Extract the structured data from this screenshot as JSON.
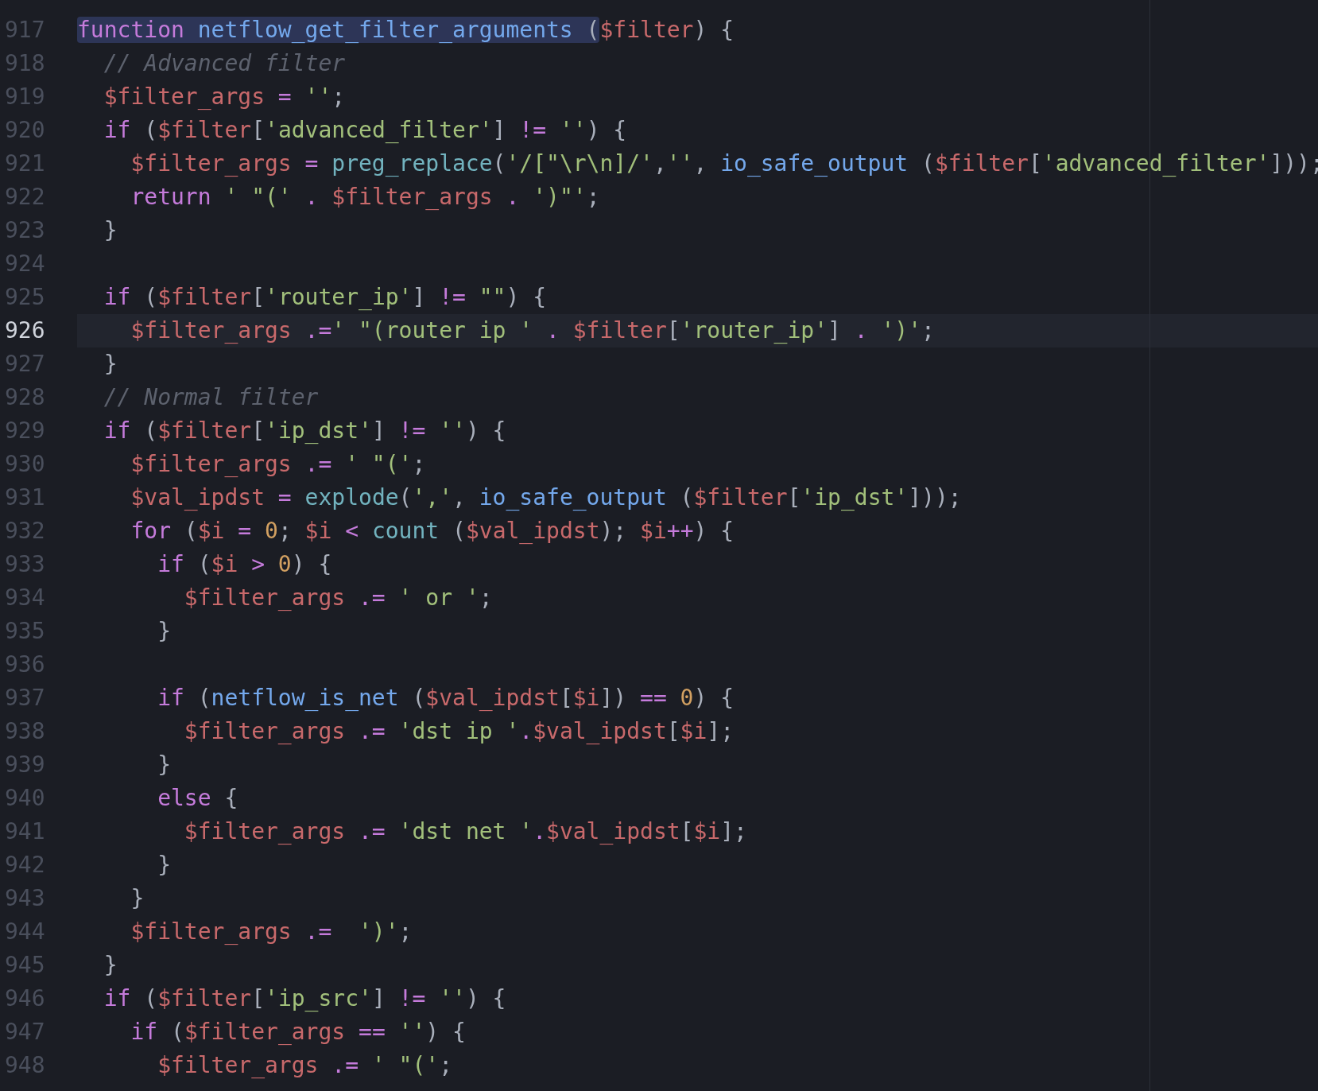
{
  "editor": {
    "lines": [
      {
        "number": "917",
        "current": false,
        "selection": [
          {
            "kind": "kw",
            "text": "function"
          },
          {
            "kind": "fn",
            "text": " netflow_get_filter_arguments"
          },
          {
            "kind": "p",
            "text": " ("
          }
        ],
        "tokens": [
          {
            "kind": "var",
            "text": "$filter"
          },
          {
            "kind": "p",
            "text": ") {"
          }
        ]
      },
      {
        "number": "918",
        "current": false,
        "tokens": [
          {
            "kind": "cm",
            "text": "  // Advanced filter"
          }
        ]
      },
      {
        "number": "919",
        "current": false,
        "tokens": [
          {
            "kind": "var",
            "text": "  $filter_args"
          },
          {
            "kind": "op",
            "text": " ="
          },
          {
            "kind": "str",
            "text": " ''"
          },
          {
            "kind": "p",
            "text": ";"
          }
        ]
      },
      {
        "number": "920",
        "current": false,
        "tokens": [
          {
            "kind": "kw",
            "text": "  if"
          },
          {
            "kind": "p",
            "text": " ("
          },
          {
            "kind": "var",
            "text": "$filter"
          },
          {
            "kind": "p",
            "text": "["
          },
          {
            "kind": "str",
            "text": "'advanced_filter'"
          },
          {
            "kind": "p",
            "text": "] "
          },
          {
            "kind": "op",
            "text": "!="
          },
          {
            "kind": "str",
            "text": " ''"
          },
          {
            "kind": "p",
            "text": ") {"
          }
        ]
      },
      {
        "number": "921",
        "current": false,
        "tokens": [
          {
            "kind": "var",
            "text": "    $filter_args"
          },
          {
            "kind": "op",
            "text": " ="
          },
          {
            "kind": "bi",
            "text": " preg_replace"
          },
          {
            "kind": "p",
            "text": "("
          },
          {
            "kind": "str",
            "text": "'/[\"\\r\\n]/'"
          },
          {
            "kind": "p",
            "text": ","
          },
          {
            "kind": "str",
            "text": "''"
          },
          {
            "kind": "p",
            "text": ", "
          },
          {
            "kind": "fn",
            "text": "io_safe_output"
          },
          {
            "kind": "p",
            "text": " ("
          },
          {
            "kind": "var",
            "text": "$filter"
          },
          {
            "kind": "p",
            "text": "["
          },
          {
            "kind": "str",
            "text": "'advanced_filter'"
          },
          {
            "kind": "p",
            "text": "]));"
          }
        ]
      },
      {
        "number": "922",
        "current": false,
        "tokens": [
          {
            "kind": "kw",
            "text": "    return"
          },
          {
            "kind": "str",
            "text": " ' \"('"
          },
          {
            "kind": "op",
            "text": " ."
          },
          {
            "kind": "var",
            "text": " $filter_args"
          },
          {
            "kind": "op",
            "text": " ."
          },
          {
            "kind": "str",
            "text": " ')\"'"
          },
          {
            "kind": "p",
            "text": ";"
          }
        ]
      },
      {
        "number": "923",
        "current": false,
        "tokens": [
          {
            "kind": "p",
            "text": "  }"
          }
        ]
      },
      {
        "number": "924",
        "current": false
      },
      {
        "number": "925",
        "current": false,
        "tokens": [
          {
            "kind": "kw",
            "text": "  if"
          },
          {
            "kind": "p",
            "text": " ("
          },
          {
            "kind": "var",
            "text": "$filter"
          },
          {
            "kind": "p",
            "text": "["
          },
          {
            "kind": "str",
            "text": "'router_ip'"
          },
          {
            "kind": "p",
            "text": "] "
          },
          {
            "kind": "op",
            "text": "!="
          },
          {
            "kind": "str",
            "text": " \"\""
          },
          {
            "kind": "p",
            "text": ") {"
          }
        ]
      },
      {
        "number": "926",
        "current": true,
        "tokens": [
          {
            "kind": "var",
            "text": "    $filter_args"
          },
          {
            "kind": "op",
            "text": " .="
          },
          {
            "kind": "str",
            "text": "' \"(router ip '"
          },
          {
            "kind": "op",
            "text": " ."
          },
          {
            "kind": "var",
            "text": " $filter"
          },
          {
            "kind": "p",
            "text": "["
          },
          {
            "kind": "str",
            "text": "'router_ip'"
          },
          {
            "kind": "p",
            "text": "] "
          },
          {
            "kind": "op",
            "text": "."
          },
          {
            "kind": "str",
            "text": " ')'"
          },
          {
            "kind": "p",
            "text": ";"
          }
        ]
      },
      {
        "number": "927",
        "current": false,
        "tokens": [
          {
            "kind": "p",
            "text": "  }"
          }
        ]
      },
      {
        "number": "928",
        "current": false,
        "tokens": [
          {
            "kind": "cm",
            "text": "  // Normal filter"
          }
        ]
      },
      {
        "number": "929",
        "current": false,
        "tokens": [
          {
            "kind": "kw",
            "text": "  if"
          },
          {
            "kind": "p",
            "text": " ("
          },
          {
            "kind": "var",
            "text": "$filter"
          },
          {
            "kind": "p",
            "text": "["
          },
          {
            "kind": "str",
            "text": "'ip_dst'"
          },
          {
            "kind": "p",
            "text": "] "
          },
          {
            "kind": "op",
            "text": "!="
          },
          {
            "kind": "str",
            "text": " ''"
          },
          {
            "kind": "p",
            "text": ") {"
          }
        ]
      },
      {
        "number": "930",
        "current": false,
        "tokens": [
          {
            "kind": "var",
            "text": "    $filter_args"
          },
          {
            "kind": "op",
            "text": " .="
          },
          {
            "kind": "str",
            "text": " ' \"('"
          },
          {
            "kind": "p",
            "text": ";"
          }
        ]
      },
      {
        "number": "931",
        "current": false,
        "tokens": [
          {
            "kind": "var",
            "text": "    $val_ipdst"
          },
          {
            "kind": "op",
            "text": " ="
          },
          {
            "kind": "bi",
            "text": " explode"
          },
          {
            "kind": "p",
            "text": "("
          },
          {
            "kind": "str",
            "text": "','"
          },
          {
            "kind": "p",
            "text": ", "
          },
          {
            "kind": "fn",
            "text": "io_safe_output"
          },
          {
            "kind": "p",
            "text": " ("
          },
          {
            "kind": "var",
            "text": "$filter"
          },
          {
            "kind": "p",
            "text": "["
          },
          {
            "kind": "str",
            "text": "'ip_dst'"
          },
          {
            "kind": "p",
            "text": "]));"
          }
        ]
      },
      {
        "number": "932",
        "current": false,
        "tokens": [
          {
            "kind": "kw",
            "text": "    for"
          },
          {
            "kind": "p",
            "text": " ("
          },
          {
            "kind": "var",
            "text": "$i"
          },
          {
            "kind": "op",
            "text": " ="
          },
          {
            "kind": "num",
            "text": " 0"
          },
          {
            "kind": "p",
            "text": "; "
          },
          {
            "kind": "var",
            "text": "$i"
          },
          {
            "kind": "op",
            "text": " <"
          },
          {
            "kind": "bi",
            "text": " count"
          },
          {
            "kind": "p",
            "text": " ("
          },
          {
            "kind": "var",
            "text": "$val_ipdst"
          },
          {
            "kind": "p",
            "text": "); "
          },
          {
            "kind": "var",
            "text": "$i"
          },
          {
            "kind": "op",
            "text": "++"
          },
          {
            "kind": "p",
            "text": ") {"
          }
        ]
      },
      {
        "number": "933",
        "current": false,
        "tokens": [
          {
            "kind": "kw",
            "text": "      if"
          },
          {
            "kind": "p",
            "text": " ("
          },
          {
            "kind": "var",
            "text": "$i"
          },
          {
            "kind": "op",
            "text": " >"
          },
          {
            "kind": "num",
            "text": " 0"
          },
          {
            "kind": "p",
            "text": ") {"
          }
        ]
      },
      {
        "number": "934",
        "current": false,
        "tokens": [
          {
            "kind": "var",
            "text": "        $filter_args"
          },
          {
            "kind": "op",
            "text": " .="
          },
          {
            "kind": "str",
            "text": " ' or '"
          },
          {
            "kind": "p",
            "text": ";"
          }
        ]
      },
      {
        "number": "935",
        "current": false,
        "tokens": [
          {
            "kind": "p",
            "text": "      }"
          }
        ]
      },
      {
        "number": "936",
        "current": false
      },
      {
        "number": "937",
        "current": false,
        "tokens": [
          {
            "kind": "kw",
            "text": "      if"
          },
          {
            "kind": "p",
            "text": " ("
          },
          {
            "kind": "fn",
            "text": "netflow_is_net"
          },
          {
            "kind": "p",
            "text": " ("
          },
          {
            "kind": "var",
            "text": "$val_ipdst"
          },
          {
            "kind": "p",
            "text": "["
          },
          {
            "kind": "var",
            "text": "$i"
          },
          {
            "kind": "p",
            "text": "]) "
          },
          {
            "kind": "op",
            "text": "=="
          },
          {
            "kind": "num",
            "text": " 0"
          },
          {
            "kind": "p",
            "text": ") {"
          }
        ]
      },
      {
        "number": "938",
        "current": false,
        "tokens": [
          {
            "kind": "var",
            "text": "        $filter_args"
          },
          {
            "kind": "op",
            "text": " .="
          },
          {
            "kind": "str",
            "text": " 'dst ip '"
          },
          {
            "kind": "op",
            "text": "."
          },
          {
            "kind": "var",
            "text": "$val_ipdst"
          },
          {
            "kind": "p",
            "text": "["
          },
          {
            "kind": "var",
            "text": "$i"
          },
          {
            "kind": "p",
            "text": "];"
          }
        ]
      },
      {
        "number": "939",
        "current": false,
        "tokens": [
          {
            "kind": "p",
            "text": "      }"
          }
        ]
      },
      {
        "number": "940",
        "current": false,
        "tokens": [
          {
            "kind": "kw",
            "text": "      else"
          },
          {
            "kind": "p",
            "text": " {"
          }
        ]
      },
      {
        "number": "941",
        "current": false,
        "tokens": [
          {
            "kind": "var",
            "text": "        $filter_args"
          },
          {
            "kind": "op",
            "text": " .="
          },
          {
            "kind": "str",
            "text": " 'dst net '"
          },
          {
            "kind": "op",
            "text": "."
          },
          {
            "kind": "var",
            "text": "$val_ipdst"
          },
          {
            "kind": "p",
            "text": "["
          },
          {
            "kind": "var",
            "text": "$i"
          },
          {
            "kind": "p",
            "text": "];"
          }
        ]
      },
      {
        "number": "942",
        "current": false,
        "tokens": [
          {
            "kind": "p",
            "text": "      }"
          }
        ]
      },
      {
        "number": "943",
        "current": false,
        "tokens": [
          {
            "kind": "p",
            "text": "    }"
          }
        ]
      },
      {
        "number": "944",
        "current": false,
        "tokens": [
          {
            "kind": "var",
            "text": "    $filter_args"
          },
          {
            "kind": "op",
            "text": " .="
          },
          {
            "kind": "str",
            "text": "  ')'"
          },
          {
            "kind": "p",
            "text": ";"
          }
        ]
      },
      {
        "number": "945",
        "current": false,
        "tokens": [
          {
            "kind": "p",
            "text": "  }"
          }
        ]
      },
      {
        "number": "946",
        "current": false,
        "tokens": [
          {
            "kind": "kw",
            "text": "  if"
          },
          {
            "kind": "p",
            "text": " ("
          },
          {
            "kind": "var",
            "text": "$filter"
          },
          {
            "kind": "p",
            "text": "["
          },
          {
            "kind": "str",
            "text": "'ip_src'"
          },
          {
            "kind": "p",
            "text": "] "
          },
          {
            "kind": "op",
            "text": "!="
          },
          {
            "kind": "str",
            "text": " ''"
          },
          {
            "kind": "p",
            "text": ") {"
          }
        ]
      },
      {
        "number": "947",
        "current": false,
        "tokens": [
          {
            "kind": "kw",
            "text": "    if"
          },
          {
            "kind": "p",
            "text": " ("
          },
          {
            "kind": "var",
            "text": "$filter_args"
          },
          {
            "kind": "op",
            "text": " =="
          },
          {
            "kind": "str",
            "text": " ''"
          },
          {
            "kind": "p",
            "text": ") {"
          }
        ]
      },
      {
        "number": "948",
        "current": false,
        "tokens": [
          {
            "kind": "var",
            "text": "      $filter_args"
          },
          {
            "kind": "op",
            "text": " .="
          },
          {
            "kind": "str",
            "text": " ' \"('"
          },
          {
            "kind": "p",
            "text": ";"
          }
        ]
      }
    ]
  }
}
